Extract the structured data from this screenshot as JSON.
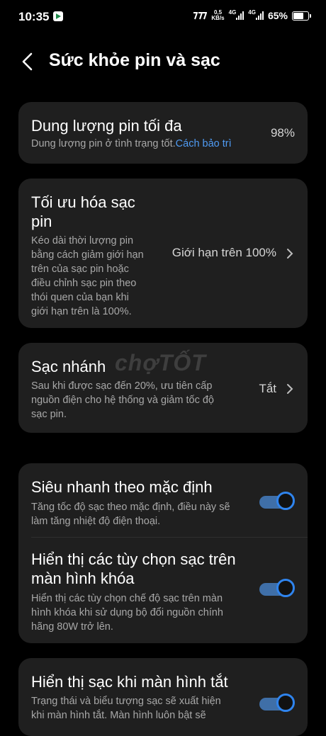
{
  "status_bar": {
    "time": "10:35",
    "speed_value": "0,5",
    "speed_unit": "KB/s",
    "net1": "4G",
    "net2": "4G",
    "battery": "65%"
  },
  "header": {
    "title": "Sức khỏe pin và sạc"
  },
  "max_capacity": {
    "title": "Dung lượng pin tối đa",
    "desc": "Dung lượng pin ở tình trạng tốt.",
    "link": "Cách bảo trì",
    "value": "98%"
  },
  "charge_optimization": {
    "title_line1": "Tối ưu hóa sạc",
    "title_line2": "pin",
    "desc_lines": [
      "Kéo dài thời lượng pin",
      "bằng cách giảm giới hạn",
      "trên của sạc pin hoặc",
      "điều chỉnh sạc pin theo",
      "thói quen của bạn khi",
      "giới hạn trên là 100%."
    ],
    "value": "Giới hạn trên 100%"
  },
  "fast_charging": {
    "title": "Sạc nhánh",
    "desc_lines": [
      "Sau khi được sạc đến 20%, ưu tiên cấp",
      "nguồn điện cho hệ thống và giảm tốc độ",
      "sạc pin."
    ],
    "value": "Tắt"
  },
  "super_fast_default": {
    "title": "Siêu nhanh theo mặc định",
    "desc_lines": [
      "Tăng tốc độ sạc theo mặc định, điều này sẽ",
      "làm tăng nhiệt độ điện thoại."
    ],
    "enabled": true
  },
  "lockscreen_options": {
    "title_line1": "Hiển thị các tùy chọn sạc trên",
    "title_line2": "màn hình khóa",
    "desc_lines": [
      "Hiển thị các tùy chọn chế độ sạc trên màn",
      "hình khóa khi sử dụng bộ đổi nguồn chính",
      "hãng 80W trở lên."
    ],
    "enabled": true
  },
  "screen_off_charging": {
    "title": "Hiển thị sạc khi màn hình tắt",
    "desc_lines": [
      "Trạng thái và biểu tượng sạc sẽ xuất hiện",
      "khi màn hình tắt. Màn hình luôn bật sẽ"
    ],
    "enabled": true
  },
  "watermark": "chợTỐT",
  "colors": {
    "background": "#000000",
    "card": "#1f1f1f",
    "accent": "#2f84ee",
    "link": "#4f9bf3"
  }
}
